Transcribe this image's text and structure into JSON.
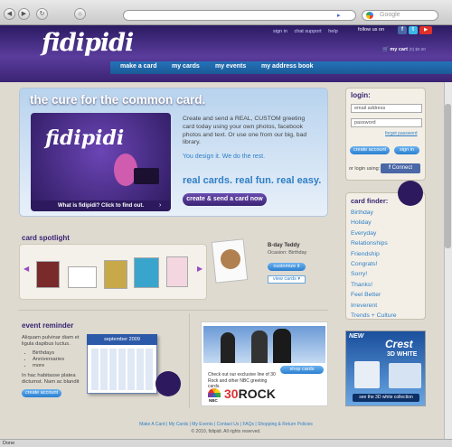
{
  "browser": {
    "search_placeholder": "Google",
    "status_text": "Done",
    "nav_icons": [
      "back-icon",
      "forward-icon",
      "reload-icon",
      "home-icon"
    ]
  },
  "header": {
    "logo": "fidipidi",
    "top_links": [
      "sign in",
      "chat support",
      "help"
    ],
    "follow_label": "follow us on",
    "cart": "my cart",
    "cart_detail": "(0) $0.00",
    "nav": [
      "make a card",
      "my cards",
      "my events",
      "my address book"
    ]
  },
  "hero": {
    "title": "the cure for the common card.",
    "body": "Create and send a REAL, CUSTOM greeting card today using your own photos, facebook photos and text. Or use one from our big, bad library.",
    "tagline": "You design it. We do the rest.",
    "slogan": "real cards. real fun. real easy.",
    "button": "create & send a card now",
    "image_logo": "fidipidi",
    "caption": "What is fidipidi? Click to find out."
  },
  "login": {
    "heading": "login:",
    "email_placeholder": "email address",
    "password_placeholder": "password",
    "forgot": "forgot password",
    "create_account": "create account",
    "sign_in": "sign in",
    "or_login": "or login using:",
    "connect": "Connect"
  },
  "finder": {
    "heading": "card finder:",
    "items": [
      "Birthday",
      "Holiday",
      "Everyday",
      "Relationships",
      "Friendship",
      "Congrats!",
      "Sorry!",
      "Thanks!",
      "Feel Better",
      "Irreverent",
      "Trends + Culture"
    ]
  },
  "spotlight": {
    "heading": "card spotlight",
    "card_title": "B-day Teddy",
    "occasion": "Ocasion: Birthday",
    "customize": "customize it",
    "view_cards": "view cards"
  },
  "event": {
    "heading": "event reminder",
    "text1": "Aliquam pulvinar diam et ligula dapibus luctus.",
    "list": [
      "Birthdays",
      "Anniversaries",
      "more"
    ],
    "text2": "In hac habitasse platea dictumst. Nam ac blandit",
    "button": "create account",
    "calendar_month": "september 2009"
  },
  "ad": {
    "button": "shop cards",
    "text": "Check out our exclusive line of 30 Rock and other NBC greeting cards.",
    "network": "NBC",
    "show_prefix": "30",
    "show_suffix": "ROCK"
  },
  "crest": {
    "new": "NEW",
    "brand": "Crest",
    "line": "3D WHITE",
    "button": "see the 3D white collection"
  },
  "footer": {
    "links": "Make A Card  |  My Cards  |  My Events  |  Contact Us  |  FAQs  |  Shopping & Return Policies",
    "copyright": "© 2010, fidipidi. All rights reserved."
  },
  "colors": {
    "brand_purple": "#3a2473",
    "link_blue": "#2f7fc6",
    "nav_blue": "#1b5a98"
  }
}
